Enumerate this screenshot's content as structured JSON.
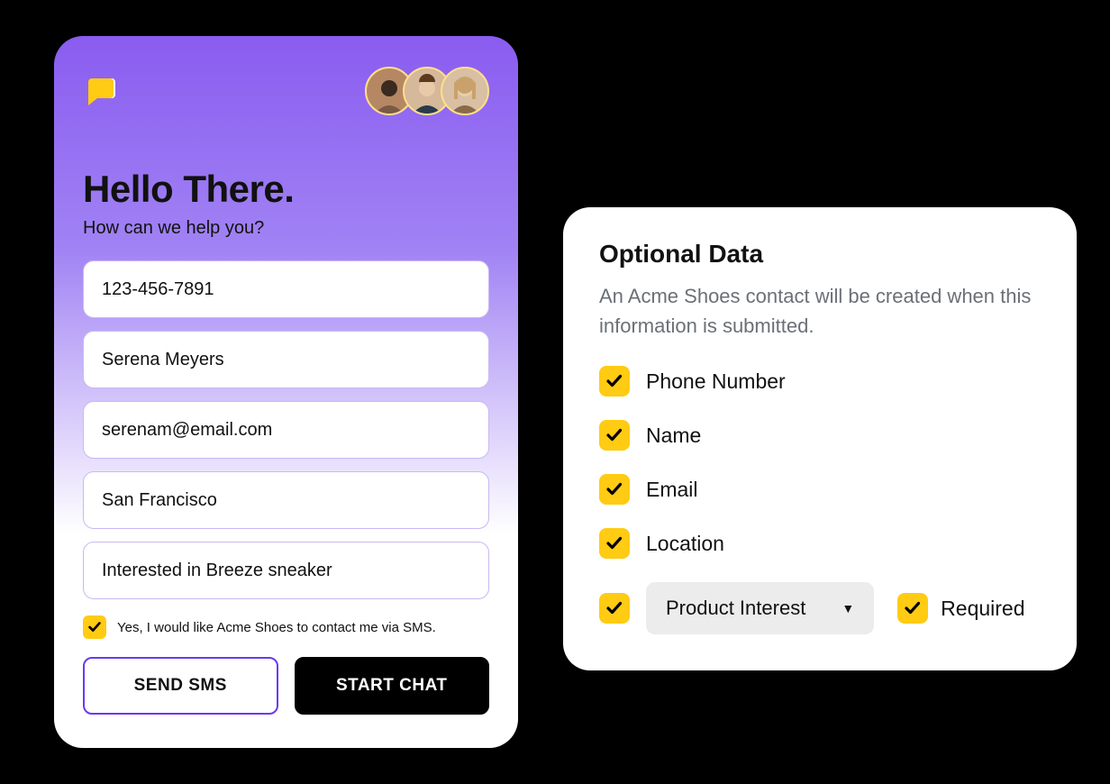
{
  "chat": {
    "title": "Hello There.",
    "subtitle": "How can we help you?",
    "fields": {
      "phone": "123-456-7891",
      "name": "Serena Meyers",
      "email": "serenam@email.com",
      "location": "San Francisco",
      "interest": "Interested in Breeze sneaker"
    },
    "consent_text": "Yes, I would like Acme Shoes to contact me via SMS.",
    "send_sms_label": "SEND SMS",
    "start_chat_label": "START CHAT",
    "icon_color_primary": "#ffcb13",
    "icon_color_secondary": "#ffffff"
  },
  "settings": {
    "title": "Optional Data",
    "description": "An Acme Shoes contact will be created when this information is submitted.",
    "options": [
      {
        "label": "Phone Number",
        "checked": true
      },
      {
        "label": "Name",
        "checked": true
      },
      {
        "label": "Email",
        "checked": true
      },
      {
        "label": "Location",
        "checked": true
      }
    ],
    "select": {
      "checked": true,
      "selected_label": "Product Interest",
      "required_label": "Required",
      "required_checked": true
    }
  },
  "colors": {
    "accent_yellow": "#ffcb13",
    "accent_purple": "#6b3af0",
    "gradient_top": "#8a5cf0"
  }
}
